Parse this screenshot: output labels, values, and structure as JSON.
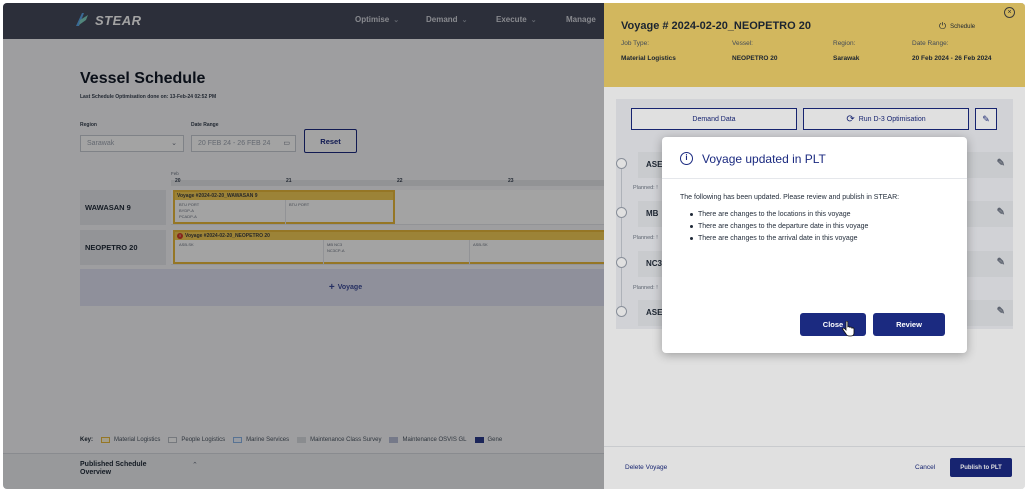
{
  "app": {
    "logo_text": "STEAR",
    "nav": [
      "Optimise",
      "Demand",
      "Execute",
      "Manage"
    ]
  },
  "page": {
    "title": "Vessel Schedule",
    "last_optimisation": "Last Schedule Optimisation done on: 13-Feb-24 02:52 PM",
    "region_label": "Region",
    "region_value": "Sarawak",
    "date_range_label": "Date Range",
    "date_range_value": "20 FEB 24 - 26 FEB 24",
    "reset_label": "Reset"
  },
  "gantt": {
    "month": "Feb",
    "days": [
      "20",
      "21",
      "22",
      "23"
    ],
    "rows": [
      {
        "vessel": "WAWASAN 9",
        "voyage": "Voyage #2024-02-20_WAWASAN 9",
        "stops_a": [
          "BTU PORT",
          "BYDP-A",
          "PCADP-A"
        ],
        "stops_b": [
          "BTU PORT"
        ]
      },
      {
        "vessel": "NEOPETRO 20",
        "voyage": "Voyage #2024-02-20_NEOPETRO 20",
        "stops_a": [
          "ASB-SK"
        ],
        "stops_b": [
          "MB NC3",
          "NC3CP-A"
        ],
        "stops_c": [
          "ASB-SK"
        ]
      }
    ],
    "add_voyage_label": "Voyage"
  },
  "key": {
    "label": "Key:",
    "items": [
      "Material Logistics",
      "People Logistics",
      "Marine Services",
      "Maintenance Class Survey",
      "Maintenance OSVIS GL",
      "Gene"
    ]
  },
  "published": {
    "title": "Published Schedule Overview"
  },
  "panel": {
    "title": "Voyage # 2024-02-20_NEOPETRO 20",
    "schedule_label": "Schedule",
    "job_type_label": "Job Type:",
    "job_type_value": "Material Logistics",
    "vessel_label": "Vessel:",
    "vessel_value": "NEOPETRO 20",
    "region_label": "Region:",
    "region_value": "Sarawak",
    "date_range_label": "Date Range:",
    "date_range_value": "20 Feb 2024 - 26 Feb 2024",
    "demand_data_label": "Demand Data",
    "run_opt_label": "Run D-3 Optimisation",
    "stops": [
      "ASE",
      "MB",
      "NC3",
      "ASE"
    ],
    "planned_label": "Planned: !",
    "delete_label": "Delete Voyage",
    "cancel_label": "Cancel",
    "publish_label": "Publish to PLT"
  },
  "modal": {
    "title": "Voyage updated in PLT",
    "message": "The following has been updated. Please review and publish in STEAR:",
    "items": [
      "There are changes to the locations in this voyage",
      "There are changes to the departure date in this voyage",
      "There are changes to the arrival date in this voyage"
    ],
    "close_label": "Close",
    "review_label": "Review"
  },
  "colors": {
    "accent": "#1b2a80",
    "panel_header": "#f0d16c",
    "voyage_bar": "#f4cd56",
    "nav": "#454a5c",
    "warning": "#d23c2a"
  }
}
